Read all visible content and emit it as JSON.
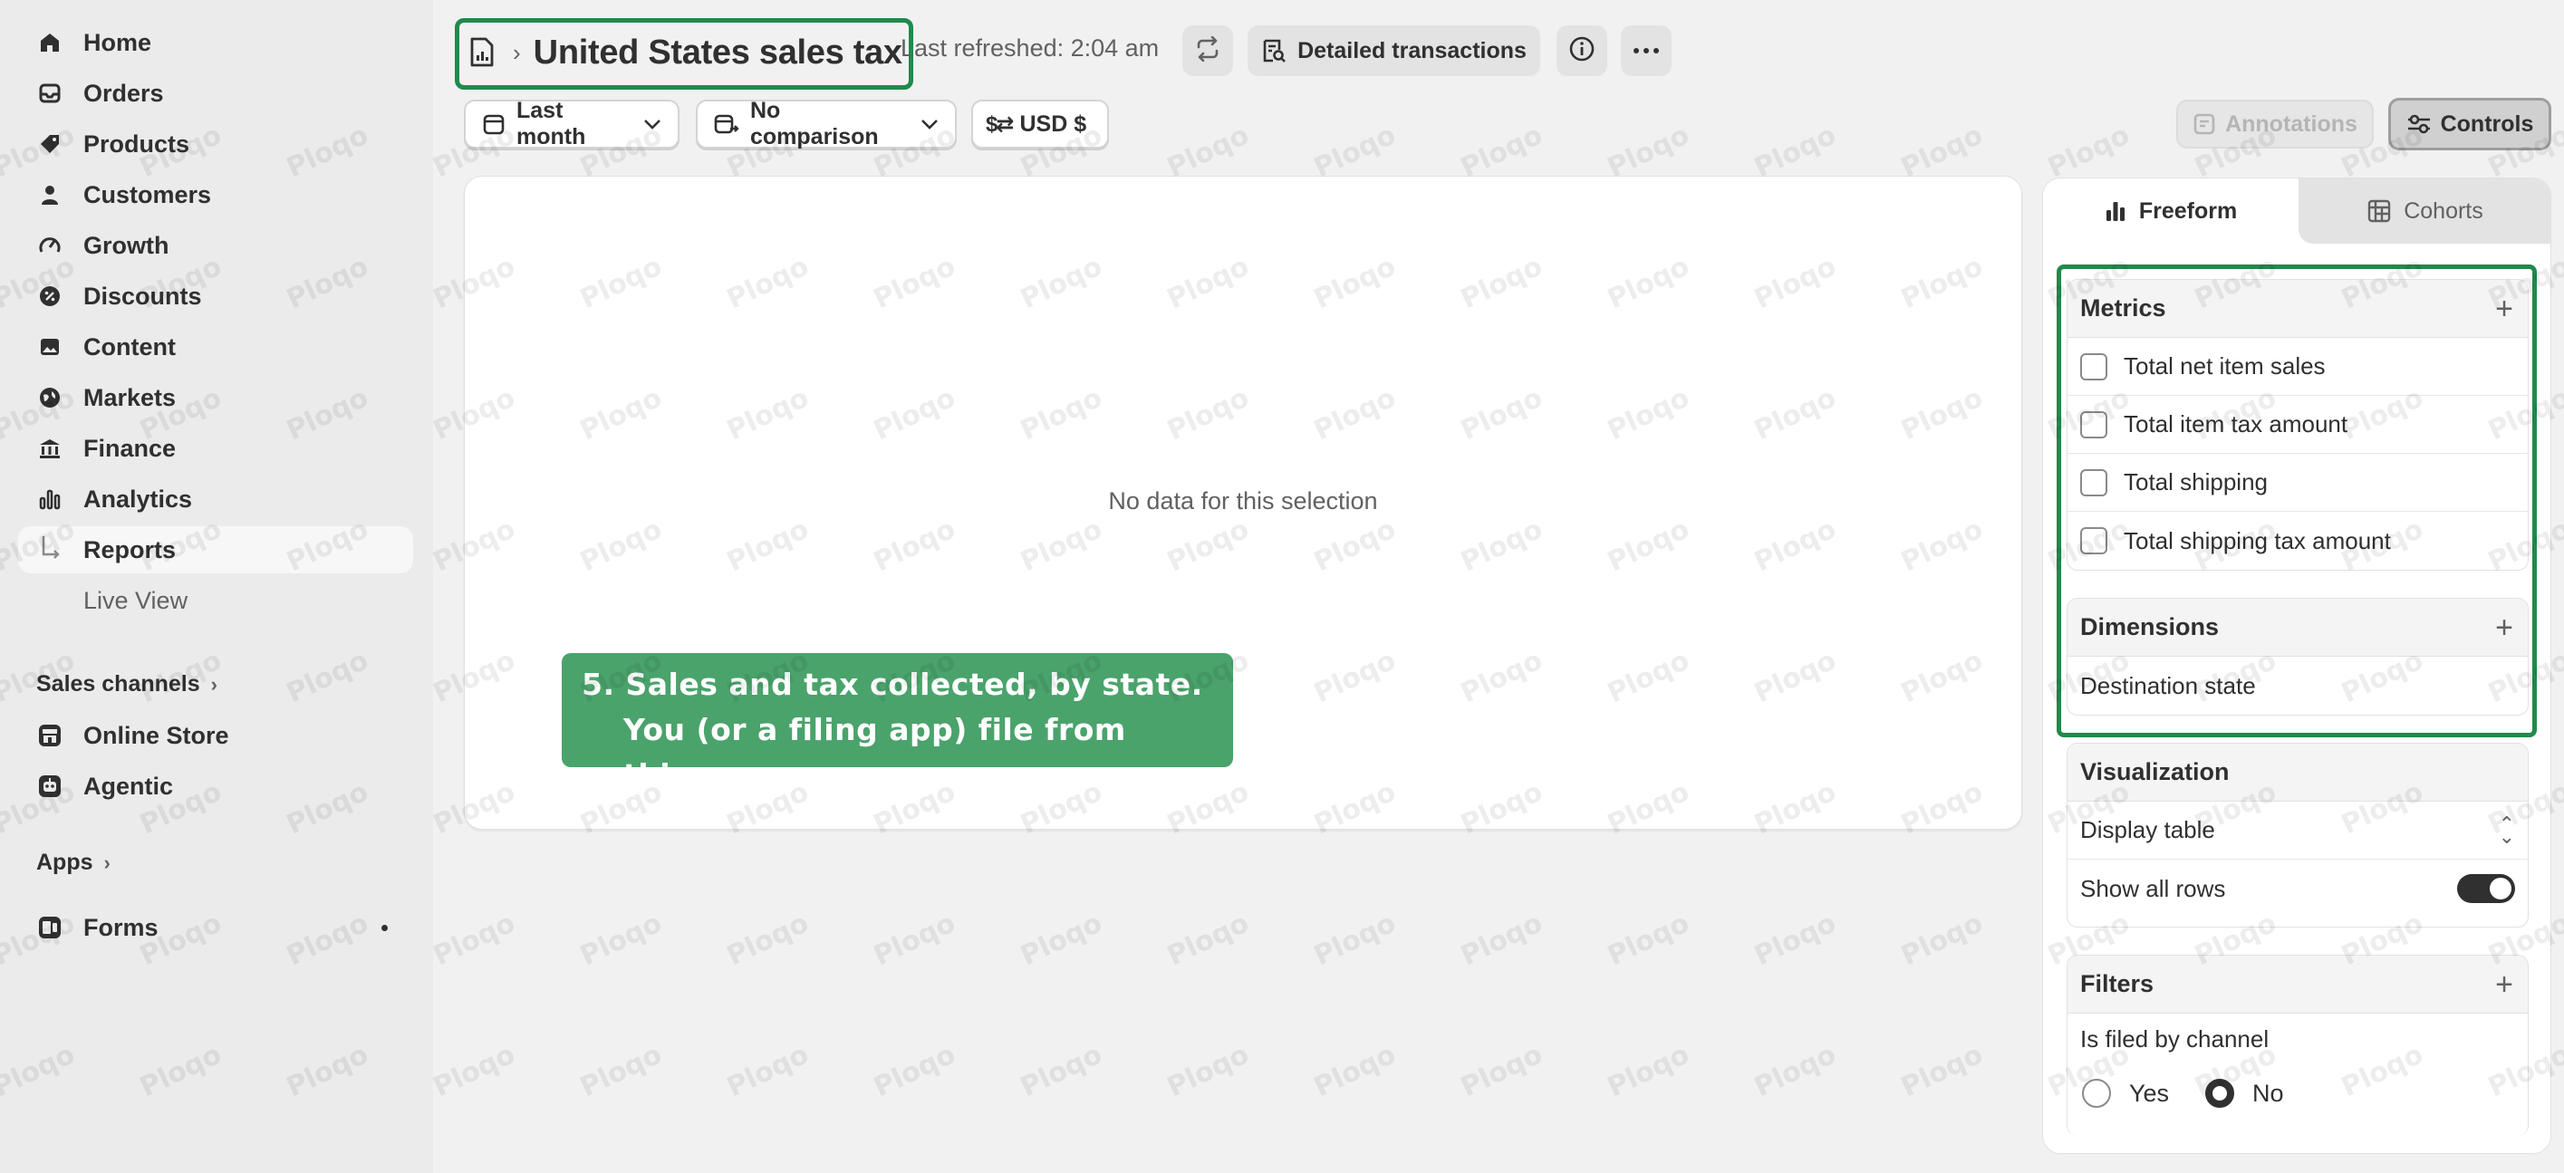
{
  "sidebar": {
    "items": [
      {
        "label": "Home",
        "icon": "home-icon"
      },
      {
        "label": "Orders",
        "icon": "inbox-icon"
      },
      {
        "label": "Products",
        "icon": "tag-icon"
      },
      {
        "label": "Customers",
        "icon": "person-icon"
      },
      {
        "label": "Growth",
        "icon": "gauge-icon"
      },
      {
        "label": "Discounts",
        "icon": "discount-icon"
      },
      {
        "label": "Content",
        "icon": "image-icon"
      },
      {
        "label": "Markets",
        "icon": "globe-icon"
      },
      {
        "label": "Finance",
        "icon": "bank-icon"
      },
      {
        "label": "Analytics",
        "icon": "bar-chart-icon"
      },
      {
        "label": "Reports",
        "icon": "sub-arrow-icon"
      },
      {
        "label": "Live View",
        "icon": ""
      }
    ],
    "sales_channels": {
      "title": "Sales channels",
      "items": [
        {
          "label": "Online Store",
          "icon": "store-icon"
        },
        {
          "label": "Agentic",
          "icon": "robot-icon"
        }
      ]
    },
    "apps": {
      "title": "Apps",
      "items": [
        {
          "label": "Forms",
          "icon": "forms-icon"
        }
      ]
    }
  },
  "header": {
    "title": "United States sales tax",
    "last_refreshed": "Last refreshed: 2:04 am",
    "detailed_transactions": "Detailed transactions"
  },
  "filters": {
    "date_range": "Last month",
    "comparison": "No comparison",
    "currency": "USD $",
    "annotations": "Annotations",
    "controls": "Controls"
  },
  "chart": {
    "empty_message": "No data for this selection"
  },
  "callout": {
    "line1": "5. Sales and tax collected, by state.",
    "line2": "You (or a filing app) file from this."
  },
  "panel": {
    "tabs": [
      {
        "label": "Freeform",
        "icon": "bar-chart-icon"
      },
      {
        "label": "Cohorts",
        "icon": "grid-icon"
      }
    ],
    "metrics": {
      "title": "Metrics",
      "items": [
        "Total net item sales",
        "Total item tax amount",
        "Total shipping",
        "Total shipping tax amount"
      ]
    },
    "dimensions": {
      "title": "Dimensions",
      "items": [
        "Destination state"
      ]
    },
    "visualization": {
      "title": "Visualization",
      "display": "Display table",
      "show_all_rows": "Show all rows"
    },
    "filters": {
      "title": "Filters",
      "label": "Is filed by channel",
      "options": [
        "Yes",
        "No"
      ],
      "selected": "No"
    }
  },
  "watermark": "Ploqo",
  "colors": {
    "highlight_border": "#1f8a4c",
    "callout_bg": "#4aa36b"
  }
}
